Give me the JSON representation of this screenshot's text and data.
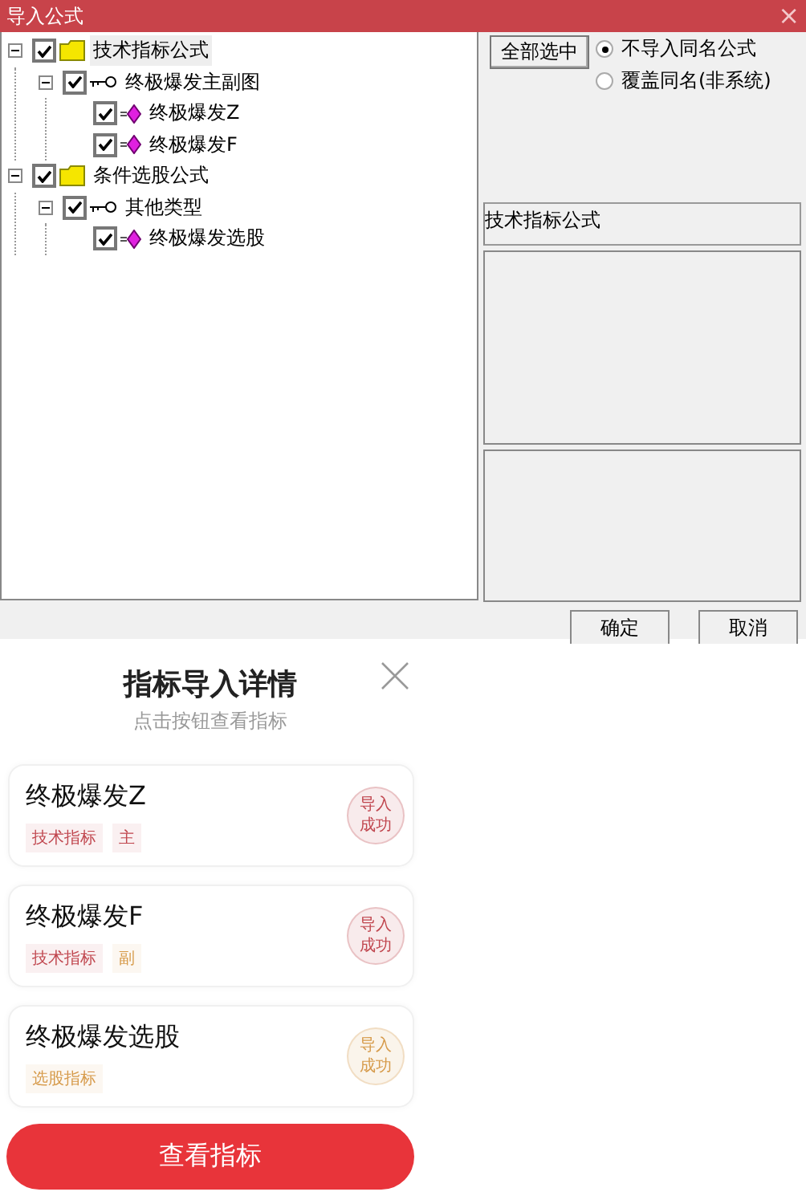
{
  "window": {
    "title": "导入公式",
    "close": "×"
  },
  "tree": [
    {
      "label": "技术指标公式",
      "kind": "folder",
      "checked": true,
      "expanded": true,
      "selected": true,
      "children": [
        {
          "label": "终极爆发主副图",
          "kind": "key",
          "checked": true,
          "expanded": true,
          "selected": false,
          "children": [
            {
              "label": "终极爆发Z",
              "kind": "diamond",
              "checked": true,
              "selected": false
            },
            {
              "label": "终极爆发F",
              "kind": "diamond",
              "checked": true,
              "selected": false
            }
          ]
        }
      ]
    },
    {
      "label": "条件选股公式",
      "kind": "folder",
      "checked": true,
      "expanded": true,
      "selected": false,
      "children": [
        {
          "label": "其他类型",
          "kind": "key",
          "checked": true,
          "expanded": true,
          "selected": false,
          "children": [
            {
              "label": "终极爆发选股",
              "kind": "diamond",
              "checked": true,
              "selected": false
            }
          ]
        }
      ]
    }
  ],
  "select_all_button": "全部选中",
  "radios": [
    {
      "label": "不导入同名公式",
      "selected": true
    },
    {
      "label": "覆盖同名(非系统)",
      "selected": false
    }
  ],
  "category_label": "技术指标公式",
  "buttons": [
    "确定",
    "取消"
  ],
  "detail": {
    "title": "指标导入详情",
    "subtitle": "点击按钮查看指标",
    "items": [
      {
        "name": "终极爆发Z",
        "tags": [
          {
            "text": "技术指标",
            "color": "#c0464e"
          },
          {
            "text": "主",
            "color": "#c0464e"
          }
        ],
        "status": "导入成功",
        "color": "#c0464e"
      },
      {
        "name": "终极爆发F",
        "tags": [
          {
            "text": "技术指标",
            "color": "#c0464e"
          },
          {
            "text": "副",
            "color": "#d69a4a"
          }
        ],
        "status": "导入成功",
        "color": "#c0464e"
      },
      {
        "name": "终极爆发选股",
        "tags": [
          {
            "text": "选股指标",
            "color": "#d69a4a"
          }
        ],
        "status": "导入成功",
        "color": "#d69a4a"
      }
    ],
    "view_button": "查看指标"
  }
}
